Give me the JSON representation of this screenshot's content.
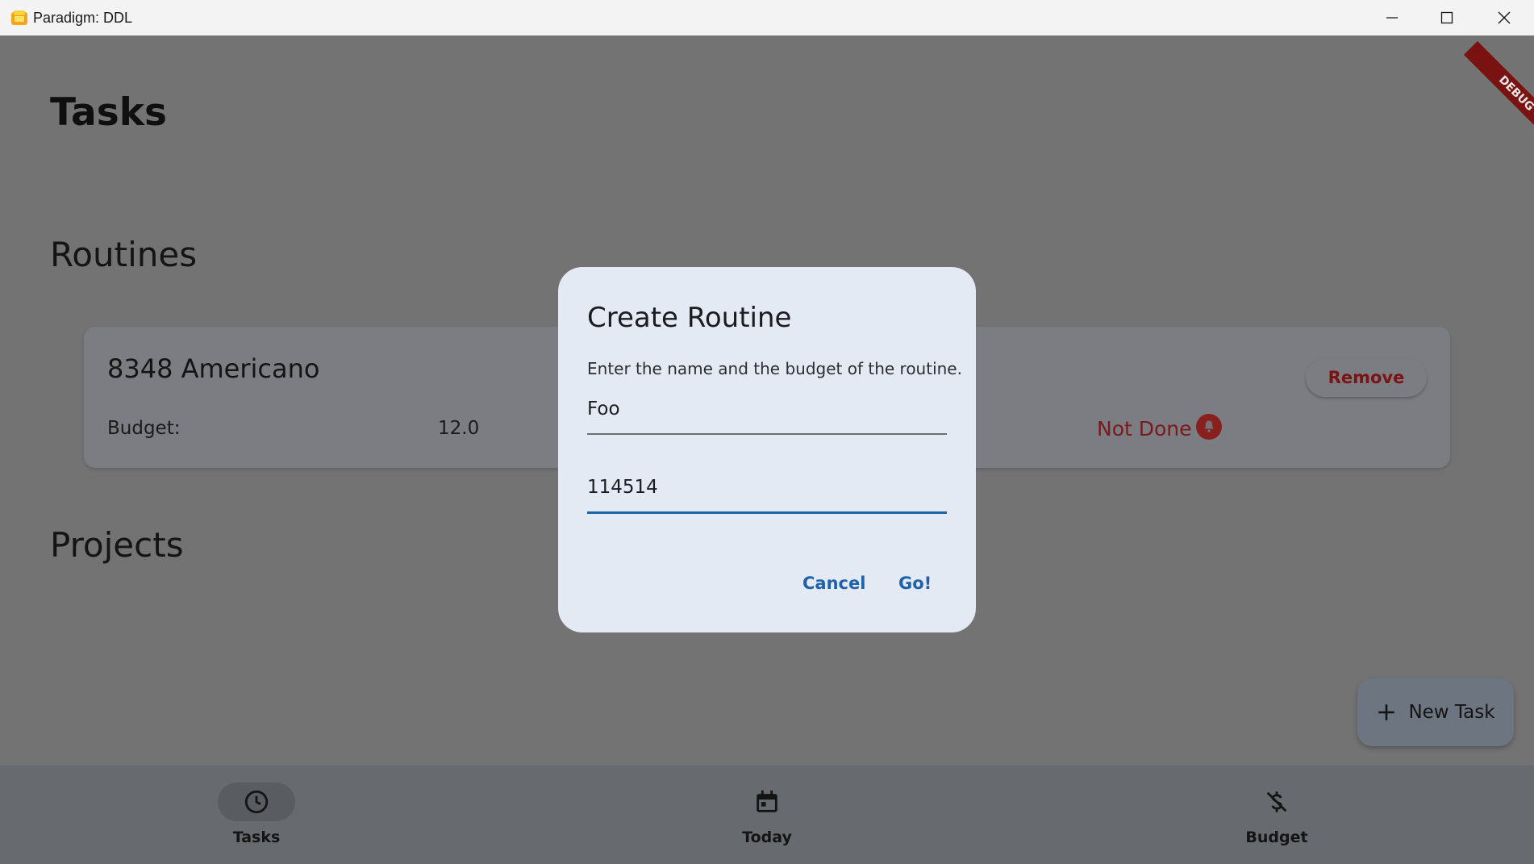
{
  "window": {
    "title": "Paradigm: DDL"
  },
  "page": {
    "title": "Tasks",
    "sections": {
      "routines": "Routines",
      "projects": "Projects"
    }
  },
  "routine_card": {
    "name": "8348 Americano",
    "budget_label": "Budget:",
    "budget_value": "12.0",
    "status": "Not Done",
    "remove_label": "Remove"
  },
  "fab": {
    "label": "New Task"
  },
  "bottom_nav": {
    "items": [
      {
        "label": "Tasks",
        "icon": "clock-icon",
        "active": true
      },
      {
        "label": "Today",
        "icon": "calendar-icon",
        "active": false
      },
      {
        "label": "Budget",
        "icon": "money-off-icon",
        "active": false
      }
    ]
  },
  "debug_banner": "DEBUG",
  "dialog": {
    "title": "Create Routine",
    "description": "Enter the name and the budget of the routine.",
    "name_value": "Foo",
    "budget_value": "114514",
    "cancel_label": "Cancel",
    "go_label": "Go!"
  },
  "colors": {
    "scrim": "#737373",
    "dialog_bg": "#e4eaf3",
    "accent": "#1f62a8",
    "danger": "#7a1414"
  }
}
